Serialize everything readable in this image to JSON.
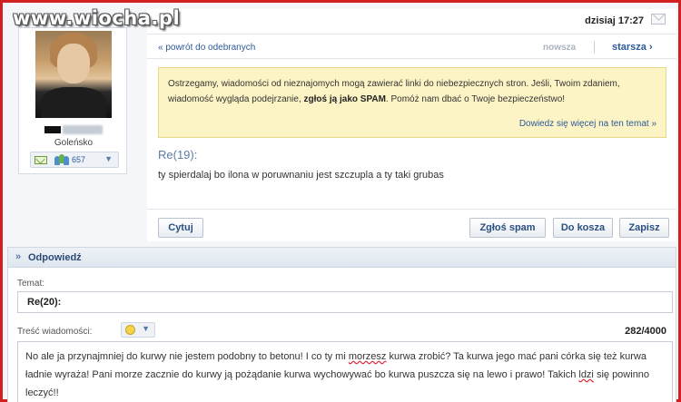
{
  "watermark": "www.wiocha.pl",
  "profile": {
    "location": "Goleńsko",
    "friends_count": "657"
  },
  "header": {
    "date": "dzisiaj 17:27"
  },
  "nav": {
    "back": "« powrót do odebranych",
    "newer": "nowsza",
    "older": "starsza ›"
  },
  "warning": {
    "text_before": "Ostrzegamy, wiadomości od nieznajomych mogą zawierać linki do niebezpiecznych stron. Jeśli, Twoim zdaniem, wiadomość wygląda podejrzanie, ",
    "bold": "zgłoś ją jako SPAM",
    "text_after": ". Pomóż nam dbać o Twoje bezpieczeństwo!",
    "more_link": "Dowiedz się więcej na ten temat »"
  },
  "message": {
    "title": "Re(19):",
    "body": "ty spierdalaj bo ilona w poruwnaniu jest szczupla a ty taki grubas"
  },
  "buttons": {
    "quote": "Cytuj",
    "spam": "Zgłoś spam",
    "trash": "Do kosza",
    "save": "Zapisz"
  },
  "reply": {
    "header": "Odpowiedź",
    "subject_label": "Temat:",
    "subject_value": "Re(20):",
    "body_label": "Treść wiadomości:",
    "counter": "282/4000",
    "body_p1": "No ale ja przynajmniej do kurwy nie jestem podobny to betonu! I co ty mi ",
    "body_w1": "morzesz",
    "body_p2": " kurwa zrobić? Ta kurwa jego mać pani córka się też kurwa ładnie wyraża! Pani morze zacznie do kurwy ją pożądanie kurwa wychowywać bo kurwa puszcza się na lewo i prawo! Takich ",
    "body_w2": "ldzi",
    "body_p3": " się powinno leczyć!!"
  },
  "colors": {
    "frame": "#d21f1f",
    "link": "#2b5a99",
    "warning_bg": "#fdf4c5"
  }
}
